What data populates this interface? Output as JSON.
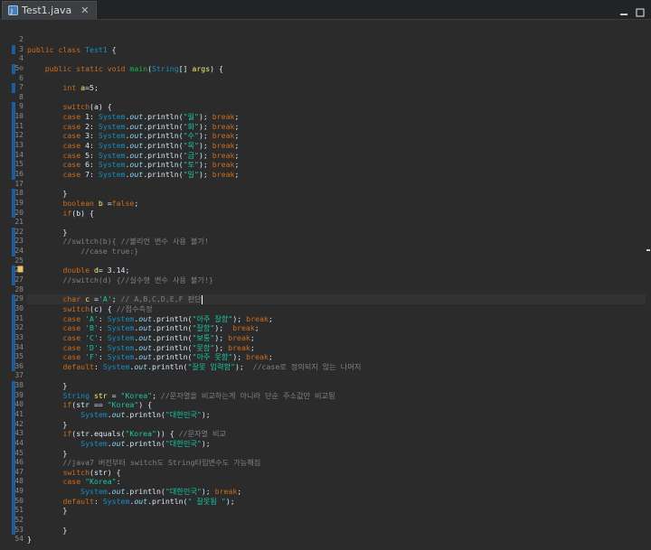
{
  "tab": {
    "title": "Test1.java",
    "close_glyph": "✕",
    "icon": "java-file-icon"
  },
  "window_controls": [
    "minimize-icon",
    "maximize-icon"
  ],
  "colors": {
    "keyword": "#cc6c1d",
    "class": "#1290c3",
    "string": "#17c6a3",
    "comment": "#808080",
    "variable": "#f3ec79",
    "field": "#8dd6f9",
    "method": "#1eb540",
    "background": "#2b2b2b"
  },
  "line_numbers": [
    "2",
    "3",
    "4",
    "5⊖",
    "6",
    "7",
    "8",
    "9",
    "10",
    "11",
    "12",
    "13",
    "14",
    "15",
    "16",
    "17",
    "18",
    "19",
    "20",
    "21",
    "22",
    "23",
    "24",
    "25",
    "26",
    "27",
    "28",
    "29",
    "30",
    "31",
    "32",
    "33",
    "34",
    "35",
    "36",
    "37",
    "38",
    "39",
    "40",
    "41",
    "42",
    "43",
    "44",
    "45",
    "46",
    "47",
    "48",
    "49",
    "50",
    "51",
    "52",
    "53",
    "54"
  ],
  "code": [
    [],
    [
      [
        "kw",
        "public class "
      ],
      [
        "cls",
        "Test1"
      ],
      [
        "pl",
        " {"
      ]
    ],
    [],
    [
      [
        "pl",
        "    "
      ],
      [
        "kw",
        "public static void "
      ],
      [
        "fn",
        "main"
      ],
      [
        "pl",
        "("
      ],
      [
        "cls",
        "String"
      ],
      [
        "pl",
        "[] "
      ],
      [
        "vr",
        "args"
      ],
      [
        "pl",
        ") {"
      ]
    ],
    [],
    [
      [
        "pl",
        "        "
      ],
      [
        "kw",
        "int "
      ],
      [
        "vr",
        "a"
      ],
      [
        "pl",
        "=5;"
      ]
    ],
    [],
    [
      [
        "pl",
        "        "
      ],
      [
        "kw",
        "switch"
      ],
      [
        "pl",
        "(a) {"
      ]
    ],
    [
      [
        "pl",
        "        "
      ],
      [
        "kw",
        "case "
      ],
      [
        "pl",
        "1: "
      ],
      [
        "cls",
        "System"
      ],
      [
        "pl",
        "."
      ],
      [
        "fld",
        "out"
      ],
      [
        "pl",
        ".println("
      ],
      [
        "st",
        "\"월\""
      ],
      [
        "pl",
        "); "
      ],
      [
        "kw",
        "break"
      ],
      [
        "pl",
        ";"
      ]
    ],
    [
      [
        "pl",
        "        "
      ],
      [
        "kw",
        "case "
      ],
      [
        "pl",
        "2: "
      ],
      [
        "cls",
        "System"
      ],
      [
        "pl",
        "."
      ],
      [
        "fld",
        "out"
      ],
      [
        "pl",
        ".println("
      ],
      [
        "st",
        "\"화\""
      ],
      [
        "pl",
        "); "
      ],
      [
        "kw",
        "break"
      ],
      [
        "pl",
        ";"
      ]
    ],
    [
      [
        "pl",
        "        "
      ],
      [
        "kw",
        "case "
      ],
      [
        "pl",
        "3: "
      ],
      [
        "cls",
        "System"
      ],
      [
        "pl",
        "."
      ],
      [
        "fld",
        "out"
      ],
      [
        "pl",
        ".println("
      ],
      [
        "st",
        "\"수\""
      ],
      [
        "pl",
        "); "
      ],
      [
        "kw",
        "break"
      ],
      [
        "pl",
        ";"
      ]
    ],
    [
      [
        "pl",
        "        "
      ],
      [
        "kw",
        "case "
      ],
      [
        "pl",
        "4: "
      ],
      [
        "cls",
        "System"
      ],
      [
        "pl",
        "."
      ],
      [
        "fld",
        "out"
      ],
      [
        "pl",
        ".println("
      ],
      [
        "st",
        "\"목\""
      ],
      [
        "pl",
        "); "
      ],
      [
        "kw",
        "break"
      ],
      [
        "pl",
        ";"
      ]
    ],
    [
      [
        "pl",
        "        "
      ],
      [
        "kw",
        "case "
      ],
      [
        "pl",
        "5: "
      ],
      [
        "cls",
        "System"
      ],
      [
        "pl",
        "."
      ],
      [
        "fld",
        "out"
      ],
      [
        "pl",
        ".println("
      ],
      [
        "st",
        "\"금\""
      ],
      [
        "pl",
        "); "
      ],
      [
        "kw",
        "break"
      ],
      [
        "pl",
        ";"
      ]
    ],
    [
      [
        "pl",
        "        "
      ],
      [
        "kw",
        "case "
      ],
      [
        "pl",
        "6: "
      ],
      [
        "cls",
        "System"
      ],
      [
        "pl",
        "."
      ],
      [
        "fld",
        "out"
      ],
      [
        "pl",
        ".println("
      ],
      [
        "st",
        "\"토\""
      ],
      [
        "pl",
        "); "
      ],
      [
        "kw",
        "break"
      ],
      [
        "pl",
        ";"
      ]
    ],
    [
      [
        "pl",
        "        "
      ],
      [
        "kw",
        "case "
      ],
      [
        "pl",
        "7: "
      ],
      [
        "cls",
        "System"
      ],
      [
        "pl",
        "."
      ],
      [
        "fld",
        "out"
      ],
      [
        "pl",
        ".println("
      ],
      [
        "st",
        "\"일\""
      ],
      [
        "pl",
        "); "
      ],
      [
        "kw",
        "break"
      ],
      [
        "pl",
        ";"
      ]
    ],
    [],
    [
      [
        "pl",
        "        }"
      ]
    ],
    [
      [
        "pl",
        "        "
      ],
      [
        "kw",
        "boolean "
      ],
      [
        "vr",
        "b"
      ],
      [
        "pl",
        " ="
      ],
      [
        "kw",
        "false"
      ],
      [
        "pl",
        ";"
      ]
    ],
    [
      [
        "pl",
        "        "
      ],
      [
        "kw",
        "if"
      ],
      [
        "pl",
        "(b) {"
      ]
    ],
    [],
    [
      [
        "pl",
        "        }"
      ]
    ],
    [
      [
        "cm",
        "        //switch(b){ //불리언 변수 사용 불가!"
      ]
    ],
    [
      [
        "cm",
        "            //case true:}"
      ]
    ],
    [],
    [
      [
        "pl",
        "        "
      ],
      [
        "kw",
        "double "
      ],
      [
        "vr",
        "d"
      ],
      [
        "pl",
        "= 3.14;"
      ]
    ],
    [
      [
        "cm",
        "        //switch(d) {//실수형 변수 사용 불가!}"
      ]
    ],
    [],
    [
      [
        "pl",
        "        "
      ],
      [
        "kw",
        "char "
      ],
      [
        "vr",
        "c"
      ],
      [
        "pl",
        " ="
      ],
      [
        "st",
        "'A'"
      ],
      [
        "pl",
        "; "
      ],
      [
        "cm",
        "// A,B,C,D,E,F 판단"
      ]
    ],
    [
      [
        "pl",
        "        "
      ],
      [
        "kw",
        "switch"
      ],
      [
        "pl",
        "(c) { "
      ],
      [
        "cm",
        "//점수측정"
      ]
    ],
    [
      [
        "pl",
        "        "
      ],
      [
        "kw",
        "case "
      ],
      [
        "st",
        "'A'"
      ],
      [
        "pl",
        ": "
      ],
      [
        "cls",
        "System"
      ],
      [
        "pl",
        "."
      ],
      [
        "fld",
        "out"
      ],
      [
        "pl",
        ".println("
      ],
      [
        "st",
        "\"아주 잘함\""
      ],
      [
        "pl",
        "); "
      ],
      [
        "kw",
        "break"
      ],
      [
        "pl",
        ";"
      ]
    ],
    [
      [
        "pl",
        "        "
      ],
      [
        "kw",
        "case "
      ],
      [
        "st",
        "'B'"
      ],
      [
        "pl",
        ": "
      ],
      [
        "cls",
        "System"
      ],
      [
        "pl",
        "."
      ],
      [
        "fld",
        "out"
      ],
      [
        "pl",
        ".println("
      ],
      [
        "st",
        "\"잘함\""
      ],
      [
        "pl",
        ");  "
      ],
      [
        "kw",
        "break"
      ],
      [
        "pl",
        ";"
      ]
    ],
    [
      [
        "pl",
        "        "
      ],
      [
        "kw",
        "case "
      ],
      [
        "st",
        "'C'"
      ],
      [
        "pl",
        ": "
      ],
      [
        "cls",
        "System"
      ],
      [
        "pl",
        "."
      ],
      [
        "fld",
        "out"
      ],
      [
        "pl",
        ".println("
      ],
      [
        "st",
        "\"보통\""
      ],
      [
        "pl",
        "); "
      ],
      [
        "kw",
        "break"
      ],
      [
        "pl",
        ";"
      ]
    ],
    [
      [
        "pl",
        "        "
      ],
      [
        "kw",
        "case "
      ],
      [
        "st",
        "'D'"
      ],
      [
        "pl",
        ": "
      ],
      [
        "cls",
        "System"
      ],
      [
        "pl",
        "."
      ],
      [
        "fld",
        "out"
      ],
      [
        "pl",
        ".println("
      ],
      [
        "st",
        "\"못함\""
      ],
      [
        "pl",
        "); "
      ],
      [
        "kw",
        "break"
      ],
      [
        "pl",
        ";"
      ]
    ],
    [
      [
        "pl",
        "        "
      ],
      [
        "kw",
        "case "
      ],
      [
        "st",
        "'F'"
      ],
      [
        "pl",
        ": "
      ],
      [
        "cls",
        "System"
      ],
      [
        "pl",
        "."
      ],
      [
        "fld",
        "out"
      ],
      [
        "pl",
        ".println("
      ],
      [
        "st",
        "\"아주 못함\""
      ],
      [
        "pl",
        "); "
      ],
      [
        "kw",
        "break"
      ],
      [
        "pl",
        ";"
      ]
    ],
    [
      [
        "pl",
        "        "
      ],
      [
        "kw",
        "default"
      ],
      [
        "pl",
        ": "
      ],
      [
        "cls",
        "System"
      ],
      [
        "pl",
        "."
      ],
      [
        "fld",
        "out"
      ],
      [
        "pl",
        ".println("
      ],
      [
        "st",
        "\"잘못 입력함\""
      ],
      [
        "pl",
        ");  "
      ],
      [
        "cm",
        "//case로 정의되지 않는 나머지"
      ]
    ],
    [],
    [
      [
        "pl",
        "        }"
      ]
    ],
    [
      [
        "pl",
        "        "
      ],
      [
        "cls",
        "String "
      ],
      [
        "vr",
        "str"
      ],
      [
        "pl",
        " = "
      ],
      [
        "st",
        "\"Korea\""
      ],
      [
        "pl",
        "; "
      ],
      [
        "cm",
        "//문자열을 비교하는게 아니라 단순 주소값만 비교됨"
      ]
    ],
    [
      [
        "pl",
        "        "
      ],
      [
        "kw",
        "if"
      ],
      [
        "pl",
        "(str == "
      ],
      [
        "st",
        "\"Korea\""
      ],
      [
        "pl",
        ") {"
      ]
    ],
    [
      [
        "pl",
        "            "
      ],
      [
        "cls",
        "System"
      ],
      [
        "pl",
        "."
      ],
      [
        "fld",
        "out"
      ],
      [
        "pl",
        ".println("
      ],
      [
        "st",
        "\"대한민국\""
      ],
      [
        "pl",
        ");"
      ]
    ],
    [
      [
        "pl",
        "        }"
      ]
    ],
    [
      [
        "pl",
        "        "
      ],
      [
        "kw",
        "if"
      ],
      [
        "pl",
        "(str.equals("
      ],
      [
        "st",
        "\"Korea\""
      ],
      [
        "pl",
        ")) { "
      ],
      [
        "cm",
        "//문자열 비교"
      ]
    ],
    [
      [
        "pl",
        "            "
      ],
      [
        "cls",
        "System"
      ],
      [
        "pl",
        "."
      ],
      [
        "fld",
        "out"
      ],
      [
        "pl",
        ".println("
      ],
      [
        "st",
        "\"대한민국\""
      ],
      [
        "pl",
        ");"
      ]
    ],
    [
      [
        "pl",
        "        }"
      ]
    ],
    [
      [
        "cm",
        "        //java7 버전부터 switch도 String타입변수도 가능해짐"
      ]
    ],
    [
      [
        "pl",
        "        "
      ],
      [
        "kw",
        "switch"
      ],
      [
        "pl",
        "(str) {"
      ]
    ],
    [
      [
        "pl",
        "        "
      ],
      [
        "kw",
        "case "
      ],
      [
        "st",
        "\"Korea\""
      ],
      [
        "pl",
        ":"
      ]
    ],
    [
      [
        "pl",
        "            "
      ],
      [
        "cls",
        "System"
      ],
      [
        "pl",
        "."
      ],
      [
        "fld",
        "out"
      ],
      [
        "pl",
        ".println("
      ],
      [
        "st",
        "\"대한민국\""
      ],
      [
        "pl",
        "); "
      ],
      [
        "kw",
        "break"
      ],
      [
        "pl",
        ";"
      ]
    ],
    [
      [
        "pl",
        "        "
      ],
      [
        "kw",
        "default"
      ],
      [
        "pl",
        ": "
      ],
      [
        "cls",
        "System"
      ],
      [
        "pl",
        "."
      ],
      [
        "fld",
        "out"
      ],
      [
        "pl",
        ".println("
      ],
      [
        "st",
        "\" 잘못됨 \""
      ],
      [
        "pl",
        ");"
      ]
    ],
    [
      [
        "pl",
        "        }"
      ]
    ],
    [],
    [
      [
        "pl",
        "        }"
      ]
    ],
    [
      [
        "pl",
        "}"
      ]
    ],
    []
  ],
  "current_line_index": 27,
  "modified_lines": [
    1,
    3,
    5,
    7,
    8,
    9,
    10,
    11,
    12,
    13,
    14,
    16,
    17,
    18,
    20,
    21,
    22,
    24,
    25,
    27,
    28,
    29,
    30,
    31,
    32,
    33,
    34,
    36,
    37,
    38,
    39,
    40,
    41,
    42,
    43,
    44,
    45,
    46,
    47,
    48,
    49,
    50,
    51
  ],
  "warning_line_index": 24
}
